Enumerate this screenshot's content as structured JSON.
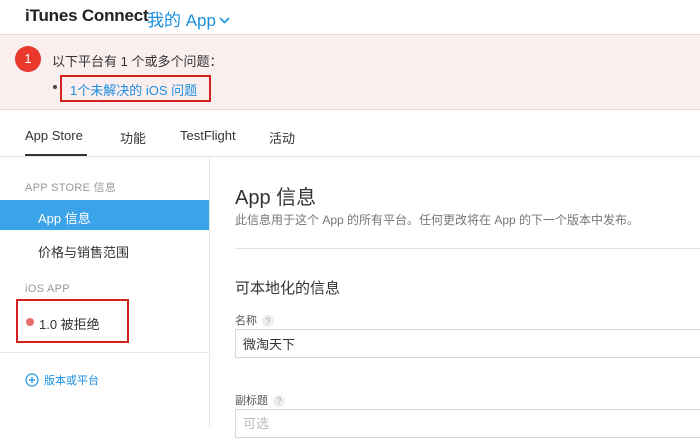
{
  "header": {
    "brand": "iTunes Connect",
    "apps_menu": "我的 App",
    "apps_menu_icon": "chevron-down-icon"
  },
  "alert": {
    "count": "1",
    "message": "以下平台有 1 个或多个问题：",
    "issue_link": "1个未解决的 iOS 问题",
    "colors": {
      "badge": "#e8392c",
      "background": "#fbeeee",
      "highlight_box": "#d62020"
    }
  },
  "tabs": [
    {
      "label": "App Store",
      "active": true
    },
    {
      "label": "功能"
    },
    {
      "label": "TestFlight"
    },
    {
      "label": "活动"
    }
  ],
  "sidebar": {
    "section_store": "APP STORE 信息",
    "items": [
      {
        "label": "App 信息",
        "active": true
      },
      {
        "label": "价格与销售范围"
      }
    ],
    "section_ios": "iOS APP",
    "version_status": "1.0 被拒绝",
    "add_version": "版本或平台",
    "colors": {
      "active_bg": "#3ba3e8",
      "status_dot": "#e86f6f"
    }
  },
  "main": {
    "title": "App 信息",
    "description": "此信息用于这个 App 的所有平台。任何更改将在 App 的下一个版本中发布。",
    "section": "可本地化的信息",
    "name_label": "名称",
    "name_value": "微淘天下",
    "subtitle_label": "副标题",
    "subtitle_placeholder": "可选",
    "help_glyph": "?"
  }
}
